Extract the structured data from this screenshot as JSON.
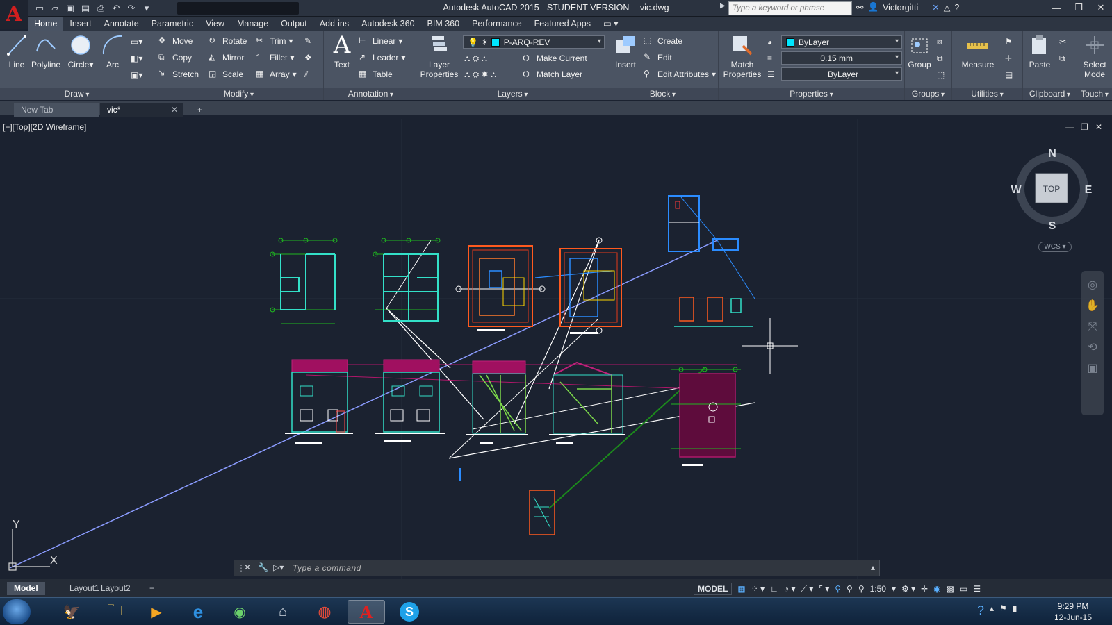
{
  "window": {
    "title": "Autodesk AutoCAD 2015 - STUDENT VERSION",
    "filename": "vic.dwg",
    "search_placeholder": "Type a keyword or phrase",
    "user": "Victorgitti"
  },
  "ribbon_tabs": [
    "Home",
    "Insert",
    "Annotate",
    "Parametric",
    "View",
    "Manage",
    "Output",
    "Add-ins",
    "Autodesk 360",
    "BIM 360",
    "Performance",
    "Featured Apps"
  ],
  "ribbon": {
    "draw": {
      "label": "Draw",
      "line": "Line",
      "polyline": "Polyline",
      "circle": "Circle",
      "arc": "Arc"
    },
    "modify": {
      "label": "Modify",
      "move": "Move",
      "rotate": "Rotate",
      "trim": "Trim",
      "copy": "Copy",
      "mirror": "Mirror",
      "fillet": "Fillet",
      "stretch": "Stretch",
      "scale": "Scale",
      "array": "Array"
    },
    "annotation": {
      "label": "Annotation",
      "text": "Text",
      "linear": "Linear",
      "leader": "Leader",
      "table": "Table"
    },
    "layers": {
      "label": "Layers",
      "layer_properties_1": "Layer",
      "layer_properties_2": "Properties",
      "current_layer": "P-ARQ-REV",
      "make_current": "Make Current",
      "match_layer": "Match Layer"
    },
    "block": {
      "label": "Block",
      "insert": "Insert",
      "create": "Create",
      "edit": "Edit",
      "edit_attributes": "Edit Attributes"
    },
    "properties": {
      "label": "Properties",
      "match_1": "Match",
      "match_2": "Properties",
      "color": "ByLayer",
      "lineweight": "0.15 mm",
      "linetype": "ByLayer"
    },
    "groups": {
      "label": "Groups",
      "group": "Group"
    },
    "utilities": {
      "label": "Utilities",
      "measure": "Measure"
    },
    "clipboard": {
      "label": "Clipboard",
      "paste": "Paste"
    },
    "touch": {
      "label": "Touch",
      "select_1": "Select",
      "select_2": "Mode"
    }
  },
  "doc_tabs": {
    "new_tab": "New Tab",
    "current": "vic*"
  },
  "viewport": {
    "label": "[−][Top][2D Wireframe]",
    "viewcube": {
      "face": "TOP",
      "n": "N",
      "s": "S",
      "e": "E",
      "w": "W",
      "wcs": "WCS"
    },
    "ucs_x": "X",
    "ucs_y": "Y"
  },
  "command": {
    "placeholder": "Type  a  command"
  },
  "layout_tabs": [
    "Model",
    "Layout1",
    "Layout2"
  ],
  "status": {
    "model": "MODEL",
    "scale": "1:50"
  },
  "taskbar": {
    "time": "9:29 PM",
    "date": "12-Jun-15"
  },
  "colors": {
    "accent_red": "#d21f1f",
    "layer_cyan": "#00e6ff",
    "canvas_bg": "#1b2230"
  }
}
